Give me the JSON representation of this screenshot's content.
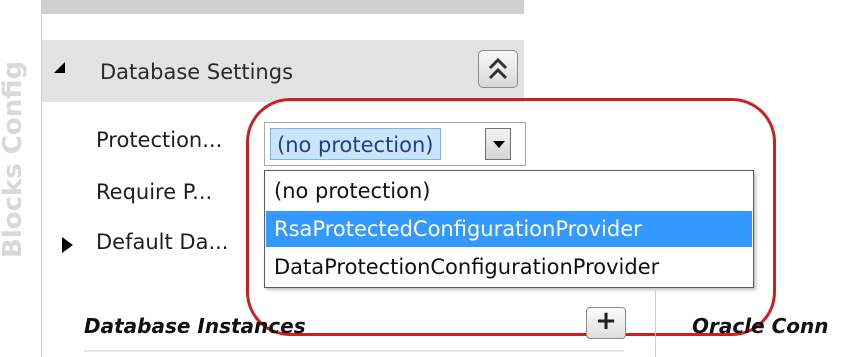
{
  "sidebar": {
    "vertical_title": "Blocks Config"
  },
  "section": {
    "title": "Database Settings"
  },
  "properties": [
    {
      "label": "Protection..."
    },
    {
      "label": "Require P..."
    },
    {
      "label": "Default Da..."
    }
  ],
  "protection_combo": {
    "selected_value": "(no protection)",
    "options": [
      "(no protection)",
      "RsaProtectedConfigurationProvider",
      "DataProtectionConfigurationProvider"
    ],
    "highlighted_option": "RsaProtectedConfigurationProvider"
  },
  "bottom": {
    "instances_title": "Database Instances",
    "oracle_title": "Oracle Conn",
    "add_label": "+"
  },
  "colors": {
    "highlight_ring": "#cc1f1f",
    "selected_option_bg": "#3399ff",
    "header_bg": "#e3e3e3"
  },
  "icons": {
    "collapse": "double-chevron-up-icon",
    "expand": "triangle-right-icon",
    "collapsed_section": "triangle-down-left-icon",
    "dropdown": "caret-down-icon"
  }
}
